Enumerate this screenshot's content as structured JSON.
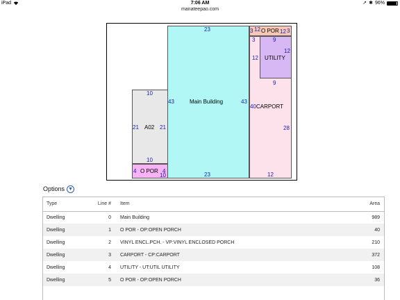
{
  "statusbar": {
    "carrier": "iPad",
    "time": "7:06 AM",
    "battery": "96%",
    "battery_level": 0.96
  },
  "browser": {
    "url": "manateepao.com"
  },
  "sketch": {
    "main": {
      "name": "Main Building",
      "top": "23",
      "bottom": "23",
      "left": "43",
      "right": "43"
    },
    "a02": {
      "name": "A02",
      "top": "10",
      "left": "21",
      "right": "21",
      "bottom": "10"
    },
    "oporch_left": {
      "name": "O POR",
      "left": "4",
      "right": "4",
      "bottom": "10"
    },
    "oporch_top": {
      "name": "O POR",
      "left": "3",
      "top": "12",
      "right_a": "12",
      "right_b": "3",
      "under": "3"
    },
    "utility": {
      "name": "UTILITY",
      "top": "9",
      "left": "12",
      "right": "12",
      "bottom": "9"
    },
    "carport": {
      "name": "CARPORT",
      "left": "40",
      "right": "28",
      "bottom": "12"
    }
  },
  "options": {
    "label": "Options"
  },
  "table": {
    "headers": {
      "type": "Type",
      "line": "Line #",
      "item": "Item",
      "area": "Area"
    },
    "rows": [
      {
        "type": "Dwelling",
        "line": "0",
        "item": "Main Building",
        "area": "989"
      },
      {
        "type": "Dwelling",
        "line": "1",
        "item": "O POR - OP:OPEN PORCH",
        "area": "40"
      },
      {
        "type": "Dwelling",
        "line": "2",
        "item": "VINYL ENCL.PCH. - VP:VINYL ENCLOSED PORCH",
        "area": "210"
      },
      {
        "type": "Dwelling",
        "line": "3",
        "item": "CARPORT - CP:CARPORT",
        "area": "372"
      },
      {
        "type": "Dwelling",
        "line": "4",
        "item": "UTILITY - UT:UTIL UTILITY",
        "area": "108"
      },
      {
        "type": "Dwelling",
        "line": "5",
        "item": "O POR - OP:OPEN PORCH",
        "area": "36"
      }
    ]
  }
}
